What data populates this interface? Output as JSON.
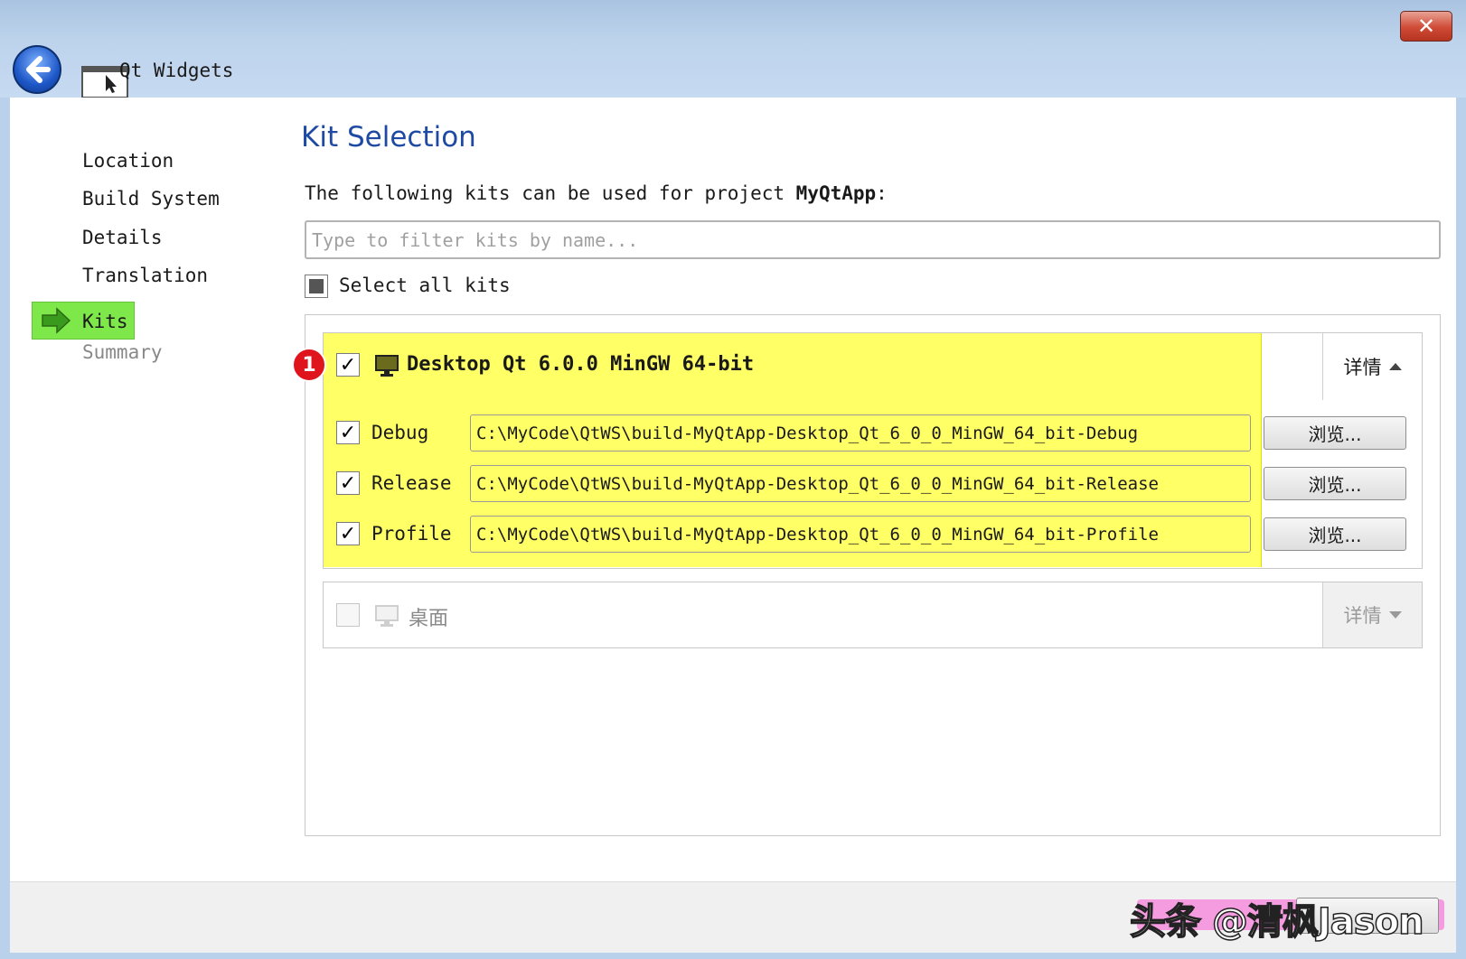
{
  "window": {
    "title": "Qt Widgets",
    "close_glyph": "✕"
  },
  "sidebar": {
    "items": [
      {
        "label": "Location",
        "state": "done"
      },
      {
        "label": "Build System",
        "state": "done"
      },
      {
        "label": "Details",
        "state": "done"
      },
      {
        "label": "Translation",
        "state": "done"
      },
      {
        "label": "Kits",
        "state": "current"
      },
      {
        "label": "Summary",
        "state": "pending"
      }
    ],
    "current_icon": "green-right-arrow-icon"
  },
  "page": {
    "title": "Kit Selection",
    "desc_prefix": "The following kits can be used for project ",
    "project_name": "MyQtApp",
    "desc_suffix": ":",
    "filter_placeholder": "Type to filter kits by name...",
    "select_all_label": "Select all kits",
    "select_all_state": "partial"
  },
  "kits": [
    {
      "name": "Desktop Qt 6.0.0 MinGW 64-bit",
      "checked": true,
      "details_label": "详情",
      "expanded": true,
      "badge": "1",
      "configs": [
        {
          "label": "Debug",
          "checked": true,
          "path": "C:\\MyCode\\QtWS\\build-MyQtApp-Desktop_Qt_6_0_0_MinGW_64_bit-Debug",
          "browse_label": "浏览..."
        },
        {
          "label": "Release",
          "checked": true,
          "path": "C:\\MyCode\\QtWS\\build-MyQtApp-Desktop_Qt_6_0_0_MinGW_64_bit-Release",
          "browse_label": "浏览..."
        },
        {
          "label": "Profile",
          "checked": true,
          "path": "C:\\MyCode\\QtWS\\build-MyQtApp-Desktop_Qt_6_0_0_MinGW_64_bit-Profile",
          "browse_label": "浏览..."
        }
      ]
    },
    {
      "name": "桌面",
      "checked": false,
      "details_label": "详情",
      "expanded": false
    }
  ],
  "check_glyph": "✓",
  "watermark": "头条 @清枫Jason",
  "colors": {
    "highlight": "#ffff66",
    "current_step": "#7ee84b",
    "title_blue": "#1f4aa3",
    "badge_red": "#e0141c"
  }
}
